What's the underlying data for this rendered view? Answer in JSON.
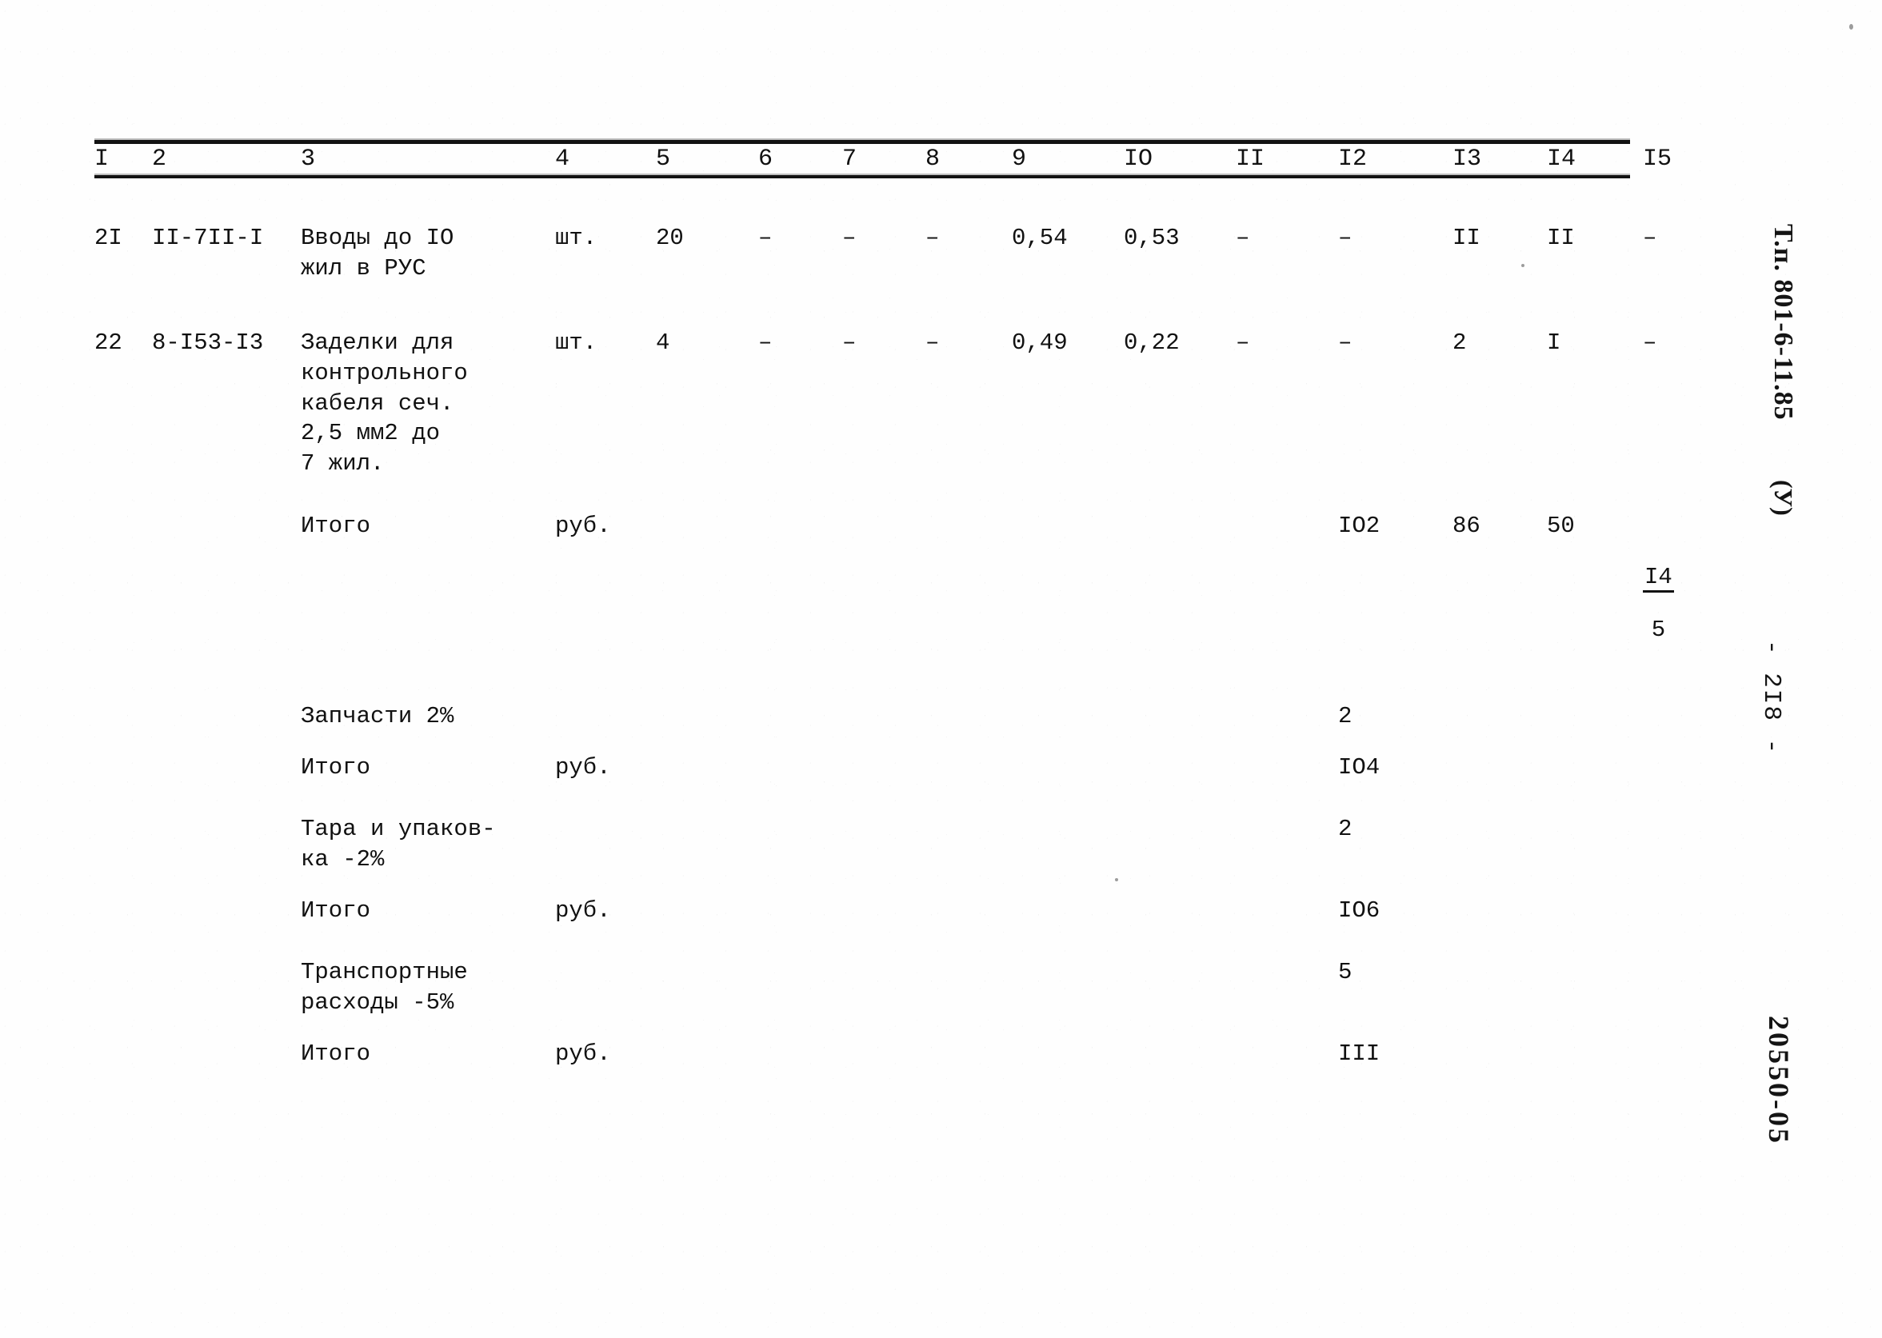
{
  "document": {
    "kind": "scanned-estimate-table",
    "stamp_code": "Т.п. 801-6-11.85",
    "stamp_variant": "(У)",
    "page_marker": "- 2I8 -",
    "stamp_archive": "20550-05"
  },
  "table": {
    "column_headers": [
      "I",
      "2",
      "3",
      "4",
      "5",
      "6",
      "7",
      "8",
      "9",
      "IO",
      "II",
      "I2",
      "I3",
      "I4",
      "I5"
    ],
    "rows": [
      {
        "id": "row-21",
        "cells": [
          "2I",
          "II-7II-I",
          "Вводы до IO\nжил в РУС",
          "шт.",
          "20",
          "–",
          "–",
          "–",
          "0,54",
          "0,53",
          "–",
          "–",
          "II",
          "II",
          "–"
        ]
      },
      {
        "id": "row-22",
        "cells": [
          "22",
          "8-I53-I3",
          "Заделки для\nконтрольного\nкабеля сеч.\n2,5 мм2 до\n7 жил.",
          "шт.",
          "4",
          "–",
          "–",
          "–",
          "0,49",
          "0,22",
          "–",
          "–",
          "2",
          "I",
          "–"
        ]
      },
      {
        "id": "row-itogo-1",
        "cells": [
          "",
          "",
          "Итого",
          "руб.",
          "",
          "",
          "",
          "",
          "",
          "",
          "",
          "IO2",
          "86",
          "50",
          ""
        ],
        "fraction": {
          "numerator": "I4",
          "denominator": "5"
        }
      },
      {
        "id": "row-zapchasti",
        "cells": [
          "",
          "",
          "Запчасти 2%",
          "",
          "",
          "",
          "",
          "",
          "",
          "",
          "",
          "2",
          "",
          "",
          ""
        ]
      },
      {
        "id": "row-itogo-2",
        "cells": [
          "",
          "",
          "Итого",
          "руб.",
          "",
          "",
          "",
          "",
          "",
          "",
          "",
          "IO4",
          "",
          "",
          ""
        ]
      },
      {
        "id": "row-tara",
        "cells": [
          "",
          "",
          "Тара и упаков-\nка -2%",
          "",
          "",
          "",
          "",
          "",
          "",
          "",
          "",
          "2",
          "",
          "",
          ""
        ]
      },
      {
        "id": "row-itogo-3",
        "cells": [
          "",
          "",
          "Итого",
          "руб.",
          "",
          "",
          "",
          "",
          "",
          "",
          "",
          "IO6",
          "",
          "",
          ""
        ]
      },
      {
        "id": "row-transport",
        "cells": [
          "",
          "",
          "Транспортные\nрасходы -5%",
          "",
          "",
          "",
          "",
          "",
          "",
          "",
          "",
          "5",
          "",
          "",
          ""
        ]
      },
      {
        "id": "row-itogo-4",
        "cells": [
          "",
          "",
          "Итого",
          "руб.",
          "",
          "",
          "",
          "",
          "",
          "",
          "",
          "III",
          "",
          "",
          ""
        ]
      }
    ]
  }
}
